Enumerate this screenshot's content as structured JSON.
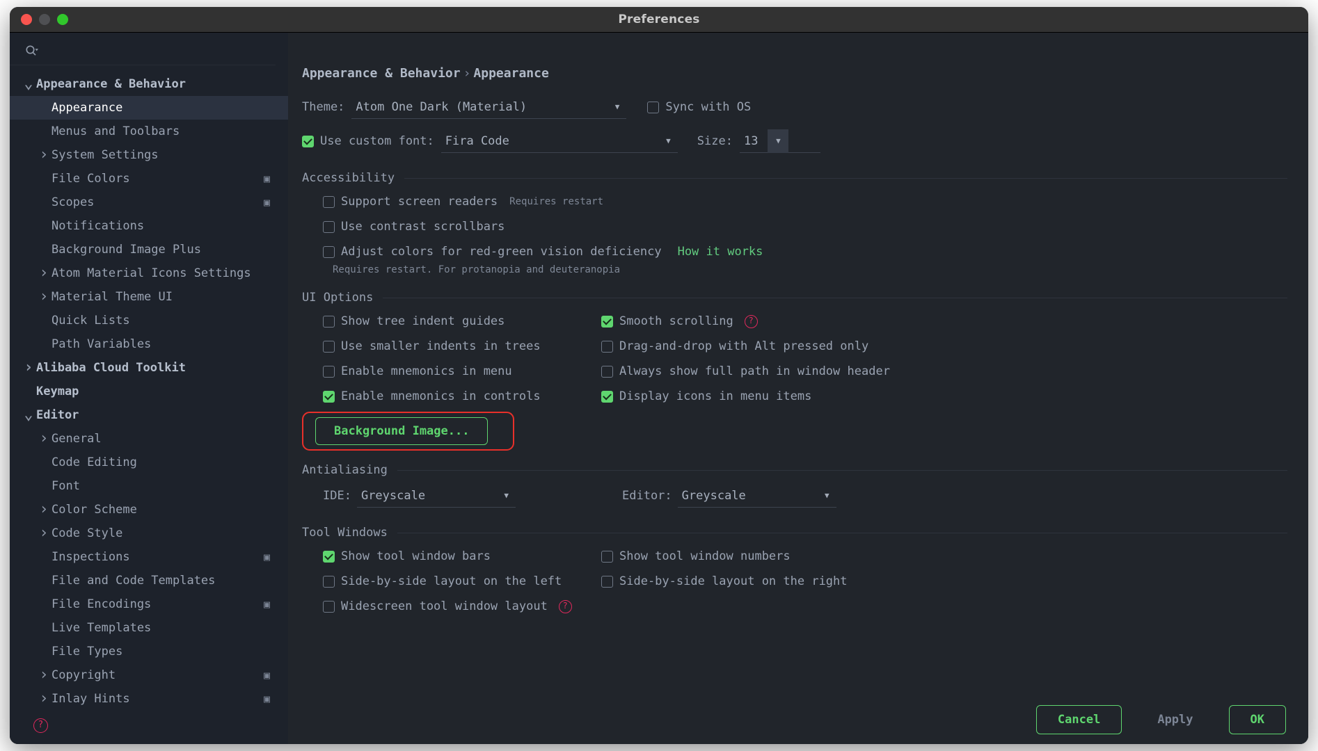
{
  "window": {
    "title": "Preferences",
    "traffic": {
      "close": "close-button",
      "minimize": "minimize-button",
      "zoom": "zoom-button"
    }
  },
  "sidebar": {
    "search_placeholder": "",
    "items": [
      {
        "label": "Appearance & Behavior",
        "level": 0,
        "arrow": "v",
        "bold": true,
        "selected": false,
        "endicon": ""
      },
      {
        "label": "Appearance",
        "level": 1,
        "arrow": "",
        "bold": false,
        "selected": true,
        "endicon": ""
      },
      {
        "label": "Menus and Toolbars",
        "level": 1,
        "arrow": "",
        "bold": false,
        "selected": false,
        "endicon": ""
      },
      {
        "label": "System Settings",
        "level": 1,
        "arrow": ">",
        "bold": false,
        "selected": false,
        "endicon": ""
      },
      {
        "label": "File Colors",
        "level": 1,
        "arrow": "",
        "bold": false,
        "selected": false,
        "endicon": "▣"
      },
      {
        "label": "Scopes",
        "level": 1,
        "arrow": "",
        "bold": false,
        "selected": false,
        "endicon": "▣"
      },
      {
        "label": "Notifications",
        "level": 1,
        "arrow": "",
        "bold": false,
        "selected": false,
        "endicon": ""
      },
      {
        "label": "Background Image Plus",
        "level": 1,
        "arrow": "",
        "bold": false,
        "selected": false,
        "endicon": ""
      },
      {
        "label": "Atom Material Icons Settings",
        "level": 1,
        "arrow": ">",
        "bold": false,
        "selected": false,
        "endicon": ""
      },
      {
        "label": "Material Theme UI",
        "level": 1,
        "arrow": ">",
        "bold": false,
        "selected": false,
        "endicon": ""
      },
      {
        "label": "Quick Lists",
        "level": 1,
        "arrow": "",
        "bold": false,
        "selected": false,
        "endicon": ""
      },
      {
        "label": "Path Variables",
        "level": 1,
        "arrow": "",
        "bold": false,
        "selected": false,
        "endicon": ""
      },
      {
        "label": "Alibaba Cloud Toolkit",
        "level": 0,
        "arrow": ">",
        "bold": true,
        "selected": false,
        "endicon": ""
      },
      {
        "label": "Keymap",
        "level": 0,
        "arrow": "",
        "bold": true,
        "selected": false,
        "endicon": ""
      },
      {
        "label": "Editor",
        "level": 0,
        "arrow": "v",
        "bold": true,
        "selected": false,
        "endicon": ""
      },
      {
        "label": "General",
        "level": 1,
        "arrow": ">",
        "bold": false,
        "selected": false,
        "endicon": ""
      },
      {
        "label": "Code Editing",
        "level": 1,
        "arrow": "",
        "bold": false,
        "selected": false,
        "endicon": ""
      },
      {
        "label": "Font",
        "level": 1,
        "arrow": "",
        "bold": false,
        "selected": false,
        "endicon": ""
      },
      {
        "label": "Color Scheme",
        "level": 1,
        "arrow": ">",
        "bold": false,
        "selected": false,
        "endicon": ""
      },
      {
        "label": "Code Style",
        "level": 1,
        "arrow": ">",
        "bold": false,
        "selected": false,
        "endicon": ""
      },
      {
        "label": "Inspections",
        "level": 1,
        "arrow": "",
        "bold": false,
        "selected": false,
        "endicon": "▣"
      },
      {
        "label": "File and Code Templates",
        "level": 1,
        "arrow": "",
        "bold": false,
        "selected": false,
        "endicon": ""
      },
      {
        "label": "File Encodings",
        "level": 1,
        "arrow": "",
        "bold": false,
        "selected": false,
        "endicon": "▣"
      },
      {
        "label": "Live Templates",
        "level": 1,
        "arrow": "",
        "bold": false,
        "selected": false,
        "endicon": ""
      },
      {
        "label": "File Types",
        "level": 1,
        "arrow": "",
        "bold": false,
        "selected": false,
        "endicon": ""
      },
      {
        "label": "Copyright",
        "level": 1,
        "arrow": ">",
        "bold": false,
        "selected": false,
        "endicon": "▣"
      },
      {
        "label": "Inlay Hints",
        "level": 1,
        "arrow": ">",
        "bold": false,
        "selected": false,
        "endicon": "▣"
      }
    ],
    "help_glyph": "?"
  },
  "main": {
    "breadcrumb": {
      "root": "Appearance & Behavior",
      "separator": "›",
      "leaf": "Appearance"
    },
    "theme": {
      "label": "Theme:",
      "value": "Atom One Dark (Material)",
      "caret": "▼",
      "sync_label": "Sync with OS",
      "sync_checked": false
    },
    "font": {
      "use_custom_label": "Use custom font:",
      "use_custom_checked": true,
      "family": "Fira Code",
      "caret": "▼",
      "size_label": "Size:",
      "size_value": "13",
      "size_caret": "▼"
    },
    "accessibility": {
      "title": "Accessibility",
      "items": [
        {
          "label": "Support screen readers",
          "checked": false,
          "hint": "Requires restart",
          "link": ""
        },
        {
          "label": "Use contrast scrollbars",
          "checked": false,
          "hint": "",
          "link": ""
        },
        {
          "label": "Adjust colors for red-green vision deficiency",
          "checked": false,
          "hint": "",
          "link": "How it works"
        }
      ],
      "note": "Requires restart. For protanopia and deuteranopia"
    },
    "ui_options": {
      "title": "UI Options",
      "left": [
        {
          "label": "Show tree indent guides",
          "checked": false,
          "badge": false
        },
        {
          "label": "Use smaller indents in trees",
          "checked": false,
          "badge": false
        },
        {
          "label": "Enable mnemonics in menu",
          "checked": false,
          "badge": false
        },
        {
          "label": "Enable mnemonics in controls",
          "checked": true,
          "badge": false
        }
      ],
      "right": [
        {
          "label": "Smooth scrolling",
          "checked": true,
          "badge": true
        },
        {
          "label": "Drag-and-drop with Alt pressed only",
          "checked": false,
          "badge": false
        },
        {
          "label": "Always show full path in window header",
          "checked": false,
          "badge": false
        },
        {
          "label": "Display icons in menu items",
          "checked": true,
          "badge": false
        }
      ],
      "background_image_button": "Background Image..."
    },
    "antialiasing": {
      "title": "Antialiasing",
      "ide_label": "IDE:",
      "ide_value": "Greyscale",
      "editor_label": "Editor:",
      "editor_value": "Greyscale",
      "caret": "▼"
    },
    "tool_windows": {
      "title": "Tool Windows",
      "left": [
        {
          "label": "Show tool window bars",
          "checked": true,
          "badge": false
        },
        {
          "label": "Side-by-side layout on the left",
          "checked": false,
          "badge": false
        },
        {
          "label": "Widescreen tool window layout",
          "checked": false,
          "badge": true
        }
      ],
      "right": [
        {
          "label": "Show tool window numbers",
          "checked": false,
          "badge": false
        },
        {
          "label": "Side-by-side layout on the right",
          "checked": false,
          "badge": false
        }
      ]
    },
    "help_badge_glyph": "?"
  },
  "footer": {
    "cancel": "Cancel",
    "apply": "Apply",
    "ok": "OK"
  },
  "colors": {
    "accent_green": "#5fd66f",
    "link_green": "#62cb7f",
    "annotation_red": "#e8302a",
    "badge_red": "#e0295c",
    "panel_bg": "#21252b",
    "sidebar_bg": "#1d222b",
    "selection_bg": "#2b3240"
  }
}
